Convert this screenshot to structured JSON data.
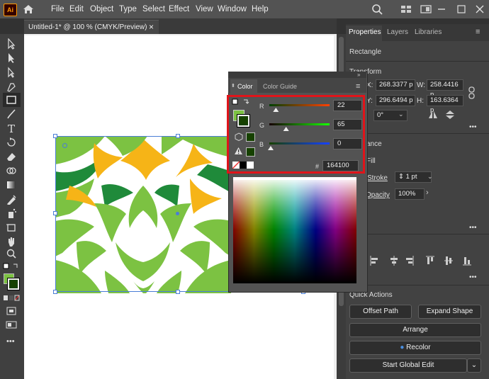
{
  "app": {
    "logo": "Ai"
  },
  "menu": [
    "File",
    "Edit",
    "Object",
    "Type",
    "Select",
    "Effect",
    "View",
    "Window",
    "Help"
  ],
  "document": {
    "tab_title": "Untitled-1* @ 100 % (CMYK/Preview)",
    "close": "×"
  },
  "color_panel": {
    "tabs": [
      "Color",
      "Color Guide"
    ],
    "r_label": "R",
    "g_label": "G",
    "b_label": "B",
    "r_value": "22",
    "g_value": "65",
    "b_value": "0",
    "hex_prefix": "#",
    "hex_value": "164100",
    "fill_color": "#164100",
    "r_level": 0.086,
    "g_level": 0.255,
    "b_level": 0.0
  },
  "properties": {
    "tabs": [
      "Properties",
      "Layers",
      "Libraries"
    ],
    "object_type": "Rectangle",
    "transform_label": "Transform",
    "x_label": "X:",
    "x_value": "268.3377 p",
    "y_label": "Y:",
    "y_value": "296.6494 p",
    "w_label": "W:",
    "w_value": "258.4416 p",
    "h_label": "H:",
    "h_value": "163.6364 p",
    "rotate_value": "0°",
    "appearance_label": "ance",
    "fill_label": "Fill",
    "stroke_label": "Stroke",
    "stroke_value": "1 pt",
    "opacity_label": "Opacity",
    "opacity_value": "100%",
    "more": "•••",
    "quick_actions_label": "Quick Actions",
    "btn_offset_path": "Offset Path",
    "btn_expand_shape": "Expand Shape",
    "btn_arrange": "Arrange",
    "btn_recolor": "Recolor",
    "btn_global_edit": "Start Global Edit"
  },
  "colors": {
    "pattern_dark_green": "#1f8a3a",
    "pattern_light_green": "#7cc242",
    "pattern_yellow": "#f6b417",
    "highlight_red": "#e0141a",
    "selection_blue": "#4a7dd6"
  }
}
